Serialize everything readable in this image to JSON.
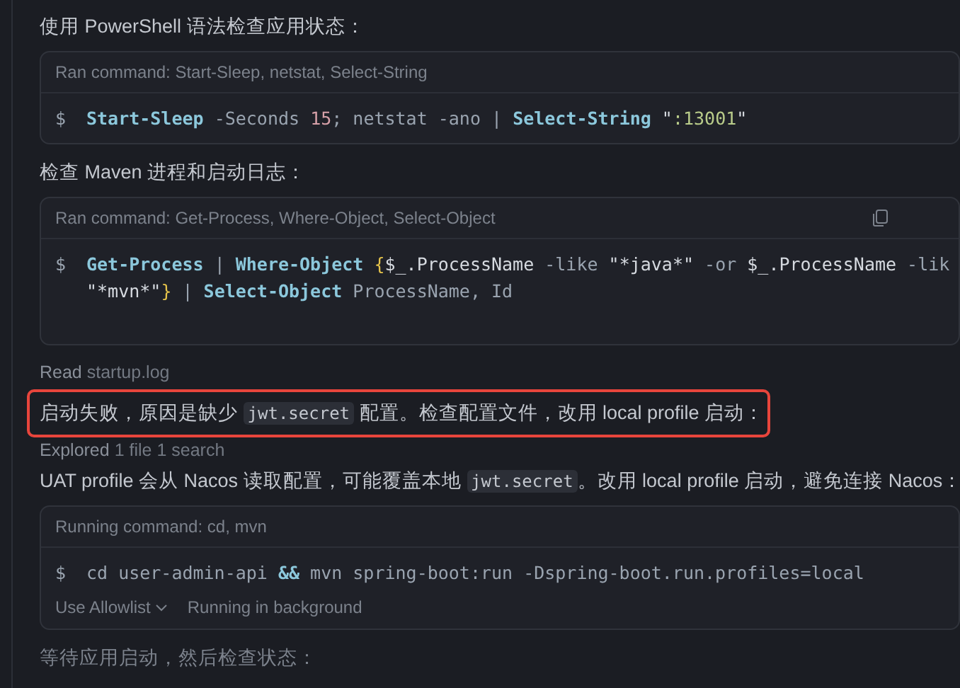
{
  "blocks": [
    {
      "kind": "text",
      "highlighted": false,
      "dimmed": false,
      "runs": [
        {
          "text": "使用 PowerShell 语法检查应用状态：",
          "code": false
        }
      ]
    },
    {
      "kind": "command",
      "header": "Ran command: Start-Sleep, netstat, Select-String",
      "copyable": false,
      "prompt": "$",
      "lines": [
        [
          {
            "text": "Start-Sleep",
            "kind": "cmd"
          },
          {
            "text": " -Seconds ",
            "kind": "param"
          },
          {
            "text": "15",
            "kind": "num"
          },
          {
            "text": "; netstat -ano | ",
            "kind": "param"
          },
          {
            "text": "Select-String",
            "kind": "cmd"
          },
          {
            "text": " \"",
            "kind": "plain"
          },
          {
            "text": ":13001",
            "kind": "str"
          },
          {
            "text": "\"",
            "kind": "plain"
          }
        ]
      ]
    },
    {
      "kind": "text",
      "highlighted": false,
      "dimmed": false,
      "runs": [
        {
          "text": "检查 Maven 进程和启动日志：",
          "code": false
        }
      ]
    },
    {
      "kind": "command",
      "header": "Ran command: Get-Process, Where-Object, Select-Object",
      "copyable": true,
      "prompt": "$",
      "lines": [
        [
          {
            "text": "Get-Process",
            "kind": "cmd"
          },
          {
            "text": " | ",
            "kind": "param"
          },
          {
            "text": "Where-Object",
            "kind": "cmd"
          },
          {
            "text": " {",
            "kind": "brace"
          },
          {
            "text": "$_.ProcessName",
            "kind": "plain"
          },
          {
            "text": " -like ",
            "kind": "param"
          },
          {
            "text": "\"*java*\"",
            "kind": "plain"
          },
          {
            "text": " -or ",
            "kind": "param"
          },
          {
            "text": "$_.ProcessName",
            "kind": "plain"
          },
          {
            "text": " -lik",
            "kind": "param"
          }
        ],
        [
          {
            "text": "\"*mvn*\"",
            "kind": "plain"
          },
          {
            "text": "}",
            "kind": "brace"
          },
          {
            "text": " | ",
            "kind": "param"
          },
          {
            "text": "Select-Object",
            "kind": "cmd"
          },
          {
            "text": " ProcessName, Id",
            "kind": "param"
          }
        ]
      ]
    },
    {
      "kind": "note",
      "verb": "Read",
      "detail": "startup.log"
    },
    {
      "kind": "text",
      "highlighted": true,
      "dimmed": false,
      "runs": [
        {
          "text": "启动失败，原因是缺少 ",
          "code": false
        },
        {
          "text": "jwt.secret",
          "code": true
        },
        {
          "text": " 配置。检查配置文件，改用 local profile 启动：",
          "code": false
        }
      ]
    },
    {
      "kind": "note",
      "verb": "Explored",
      "detail": "1 file 1 search"
    },
    {
      "kind": "text",
      "highlighted": false,
      "dimmed": false,
      "runs": [
        {
          "text": "UAT profile 会从 Nacos 读取配置，可能覆盖本地 ",
          "code": false
        },
        {
          "text": "jwt.secret",
          "code": true
        },
        {
          "text": "。改用 local profile 启动，避免连接 Nacos：",
          "code": false
        }
      ]
    },
    {
      "kind": "command",
      "header": "Running command: cd, mvn",
      "copyable": false,
      "prompt": "$",
      "lines": [
        [
          {
            "text": "cd user-admin-api ",
            "kind": "param"
          },
          {
            "text": "&&",
            "kind": "op"
          },
          {
            "text": " mvn spring-boot:run -Dspring-boot.run.profiles=local",
            "kind": "param"
          }
        ]
      ],
      "footer": [
        {
          "label": "Use Allowlist",
          "dropdown": true
        },
        {
          "label": "Running in background",
          "dropdown": false
        }
      ]
    },
    {
      "kind": "text",
      "highlighted": false,
      "dimmed": true,
      "runs": [
        {
          "text": "等待应用启动，然后检查状态：",
          "code": false
        }
      ]
    }
  ]
}
